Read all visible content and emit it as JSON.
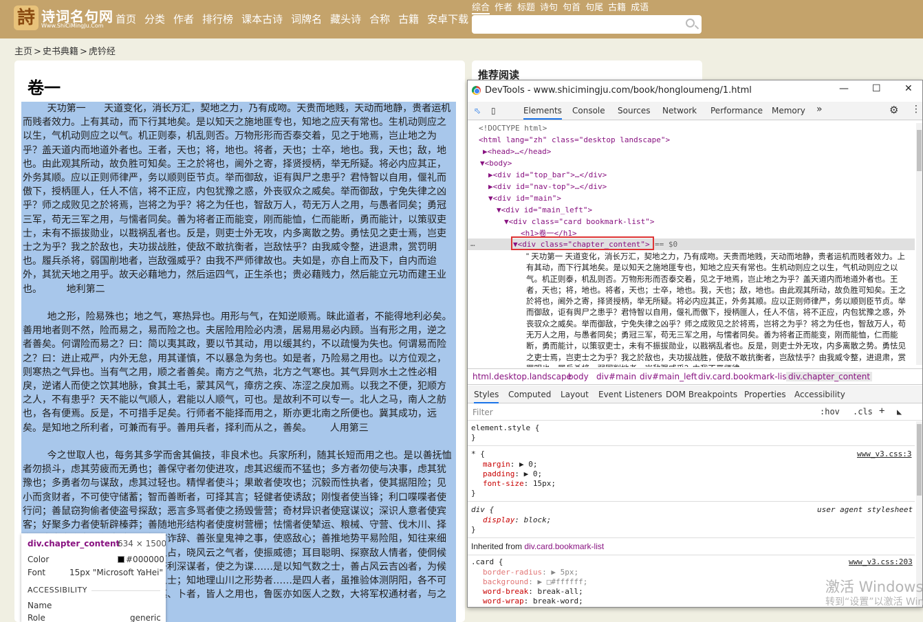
{
  "site": {
    "logo_text": "诗词名句网",
    "logo_sub": "Www.ShiCiMingJu.Com",
    "nav": [
      "首页",
      "分类",
      "作者",
      "排行榜",
      "课本古诗",
      "词牌名",
      "藏头诗",
      "合称",
      "古籍",
      "安卓下载"
    ],
    "search_tabs": [
      "综合",
      "作者",
      "标题",
      "诗句",
      "句首",
      "句尾",
      "古籍",
      "成语"
    ],
    "search_placeholder": ""
  },
  "breadcrumb": [
    "主页",
    "史书典籍",
    "虎钤经"
  ],
  "breadcrumb_sep": ">",
  "card": {
    "title": "卷一",
    "content": "        天功第一      天道变化，消长万汇，契地之力，乃有成吻。天贵而地贱，天动而地静，贵者运机而贱者效力。上有其动，而下行其地矣。是以知天之施地匪专也，知地之应天有常也。生机动则应之以生，气机动则应之以气。机正则泰，机乱则否。万物形形而否泰交着，见之于地焉，岂止地之为乎？盖天道内而地道外者也。王者，天也；将，地也。将者，天也；士卒，地也。我，天也；敌，地也。由此观其所动，故负胜可知矣。王之於将也，阃外之寄，择贤授柄，举无所疑。将必内应其正，外务其顺。应以正则师律严，务以顺则臣节贞。举而御敌，讵有舆尸之患乎？君恃智以自用，偃礼而傲下，授柄匪人，任人不信，将不正应，内包犹豫之惑，外丧驭众之威矣。举而御敌，宁免失律之凶乎？师之成败见之於将焉，岂将之为乎？将之为任也，智敌万人，苟无万人之用，与愚者同矣；勇冠三军，苟无三军之用，与懦者同矣。善为将者正而能变，刚而能恤，仁而能断，勇而能计，以策驭吏士，未有不振拔勋业，以戡祸乱者也。反是，则吏士外无攻，内多离散之势。勇怯见之吏士焉，岂吏士之为乎？我之於敌也，夫功拔战胜，使敌不敢抗衡者，岂敌怯乎？由我威令整，进退肃，赏罚明也。履兵杀将，弱国削地者，岂敌强威乎？由我不严师律故也。夫如是，亦自上而及下，自内而迨外，其犹天地之用乎。故天必藉地力，然后运四气，正生杀也；贵必藉贱力，然后能立元功而建王业也。        地利第二\n\n        地之形，险易殊也；地之气，寒热异也。用形与气，在知逆顺焉。昧此道者，不能得地利必矣。善用地者则不然，险而易之，易而险之也。夫居险用险必内溃，居易用易必内顾。当有形之用，逆之者善矣。何谓险而易之？曰：简以夷其政，要以节其动，用以缓其约，不以疏慢为失也。何谓易而险之？曰：进止戒严，内外无怠，用其谨慎，不以暴急为务也。如是者，乃险易之用也。以方位观之，则寒热之气异也。当有气之用，顺之者善矣。南方之气热，北方之气寒也。其气异则水土之性必相戾，逆诸人而使之饮其地脉，食其土毛，蒙其风气，瘴疠之疾、冻涩之戾加焉。以我之不便，犯顺方之人，不有患乎？天不能以气顺人，君能以人顺气，可也。是故利不可以专一。北人之马，南人之舫也，各有便焉。反是，不可措手足矣。行师者不能择而用之，斯亦更北南之所便也。冀其成功，远矣。是知地之所利者，可兼而有乎。善用兵者，择利而从之，善矣。      人用第三\n\n        今之世取人也，每务其多学而舍其偏技，非良术也。兵家所利，随其长短而用之也。是以善抚恤者勿损斗，虑其劳疲而无勇也；善保守者勿使进攻，虑其迟缓而不猛也；多方者勿使与决事，虑其犹豫也；多勇者勿与谋敌，虑其过轻也。精悍者使斗；果敢者使攻也；沉毅而性执者，使其据阻险；见小而贪财者，不可使守储蓄；智而善断者，可择其言；轻健者使诱敌；刚愎者使当锋；利口喋喋者使行问；善鼠窃狗偷者使盗号探敌；恶言多骂者使之扬毁訾营；奇材异识者使寇谋议；深识人意者使宾客；好聚多力者使斩辟榛莽；善随地形结构者使度树营栅；怯懦者使辇运、粮械、守营、伐木川、择高下水泉之利者，使察地形；妖言诈辞、善张皇鬼神之事，使惑敌心；善推地势平易险阻，知往来细大之蹊路者，使通粮储；知天时之占，晓风云之气者，使振威德；耳目聪明、探察敌人情者，使侗候奸伪；敏才健笔者，使为文檄；好利深谋者，使之为谍……是以知气数之士，善占风云吉凶者，为候气之士；晓六壬遁甲者，为选日之士；知地理山川之形势者……是四人者，虽推验体测阴阳，各不可使相乱，贵其专一也。医、工、巫、卜者，皆人之用也，鲁医亦如医人之数，大将军权通材者，与之参议可否，故我"
  },
  "sidebar": {
    "title": "推荐阅读"
  },
  "tooltip": {
    "selector": "div.chapter_content",
    "size": "634 × 1500",
    "color_label": "Color",
    "color_value": "#000000",
    "font_label": "Font",
    "font_value": "15px \"Microsoft YaHei\"",
    "section": "ACCESSIBILITY",
    "name_label": "Name",
    "role_label": "Role",
    "role_value": "generic"
  },
  "devtools": {
    "title": "DevTools - www.shicimingju.com/book/hongloumeng/1.html",
    "tabs": [
      "Elements",
      "Console",
      "Sources",
      "Network",
      "Performance",
      "Memory"
    ],
    "more_tabs": "»",
    "dom_lines": [
      "<!DOCTYPE html>",
      "<html lang=\"zh\" class=\"desktop landscape\">",
      "▶<head>…</head>",
      "▼<body>",
      "▶<div id=\"top_bar\">…</div>",
      "▶<div id=\"nav-top\">…</div>",
      "▼<div id=\"main\">",
      "▼<div id=\"main_left\">",
      "▼<div class=\"card bookmark-list\">",
      "<h1>卷一</h1>"
    ],
    "selected_line": "<div class=\"chapter_content\">",
    "selected_suffix": "== $0",
    "ellipsis": "…",
    "text_node": "\" 天功第一  天道变化，消长万汇，契地之力，乃有成吻。天贵而地贱，天动而地静，贵者运机而贱者效力。上有其动，而下行其地矣。是以知天之施地匪专也，知地之应天有常也。生机动则应之以生，气机动则应之以气。机正则泰，机乱则否。万物形形而否泰交着，见之于地焉，岂止地之为乎？盖天道内而地道外者也。王者，天也；将，地也。将者，天也；士卒，地也。我，天也；敌，地也。由此观其所动，故负胜可知矣。王之於将也，阃外之寄，择贤授柄，举无所疑。将必内应其正，外务其顺。应以正则师律严，务以顺则臣节贞。举而御敌，讵有舆尸之患乎？君恃智以自用，偃礼而傲下，授柄匪人，任人不信，将不正应，内包犹豫之惑，外丧驭众之威矣。举而御敌，宁免失律之凶乎？师之成败见之於将焉，岂将之为乎？将之为任也，智敌万人，苟无万人之用，与愚者同矣；勇冠三军，苟无三军之用，与懦者同矣。善为将者正而能变，刚而能恤，仁而能断，勇而能计，以策驭吏士，未有不振拔勋业，以戡祸乱者也。反是，则吏士外无攻，内多离散之势。勇怯见之吏士焉，岂吏士之为乎？我之於敌也，夫功拔战胜，使敌不敢抗衡者，岂敌怯乎？由我威令整，进退肃，赏罚明也。履兵杀将，弱国削地者，岂敌强威乎？由我不严师律",
    "breadcrumbs": [
      "html.desktop.landscape",
      "body",
      "div#main",
      "div#main_left",
      "div.card.bookmark-list",
      "div.chapter_content"
    ],
    "panel_tabs": [
      "Styles",
      "Computed",
      "Layout",
      "Event Listeners",
      "DOM Breakpoints",
      "Properties",
      "Accessibility"
    ],
    "filter_placeholder": "Filter",
    "filter_hov": ":hov",
    "filter_cls": ".cls",
    "styles": {
      "element_style": "element.style {",
      "close": "}",
      "rule1_selector": "* {",
      "rule1_source": "www_v3.css:3",
      "rule1_props": [
        [
          "margin",
          ": ▶ 0;"
        ],
        [
          "padding",
          ": ▶ 0;"
        ],
        [
          "font-size",
          ": 15px;"
        ]
      ],
      "rule2_selector": "div {",
      "rule2_source": "user agent stylesheet",
      "rule2_props": [
        [
          "display",
          ": block;"
        ]
      ],
      "inherited_label": "Inherited from",
      "inherited_from": "div.card.bookmark-list",
      "rule3_selector": ".card {",
      "rule3_source": "www_v3.css:203",
      "rule3_props": [
        [
          "border-radius",
          ": ▶ 5px;"
        ],
        [
          "background",
          ": ▶ □#ffffff;"
        ],
        [
          "word-break",
          ": break-all;"
        ],
        [
          "word-wrap",
          ": break-word;"
        ]
      ]
    }
  },
  "watermark": {
    "line1": "激活 Windows",
    "line2": "转到“设置”以激活 Windows。"
  },
  "colors": {
    "topbar": "#c4a36b",
    "page_bg": "#f0efe2",
    "selection": "#a8c7eb",
    "highlight_box": "#dd3333"
  }
}
